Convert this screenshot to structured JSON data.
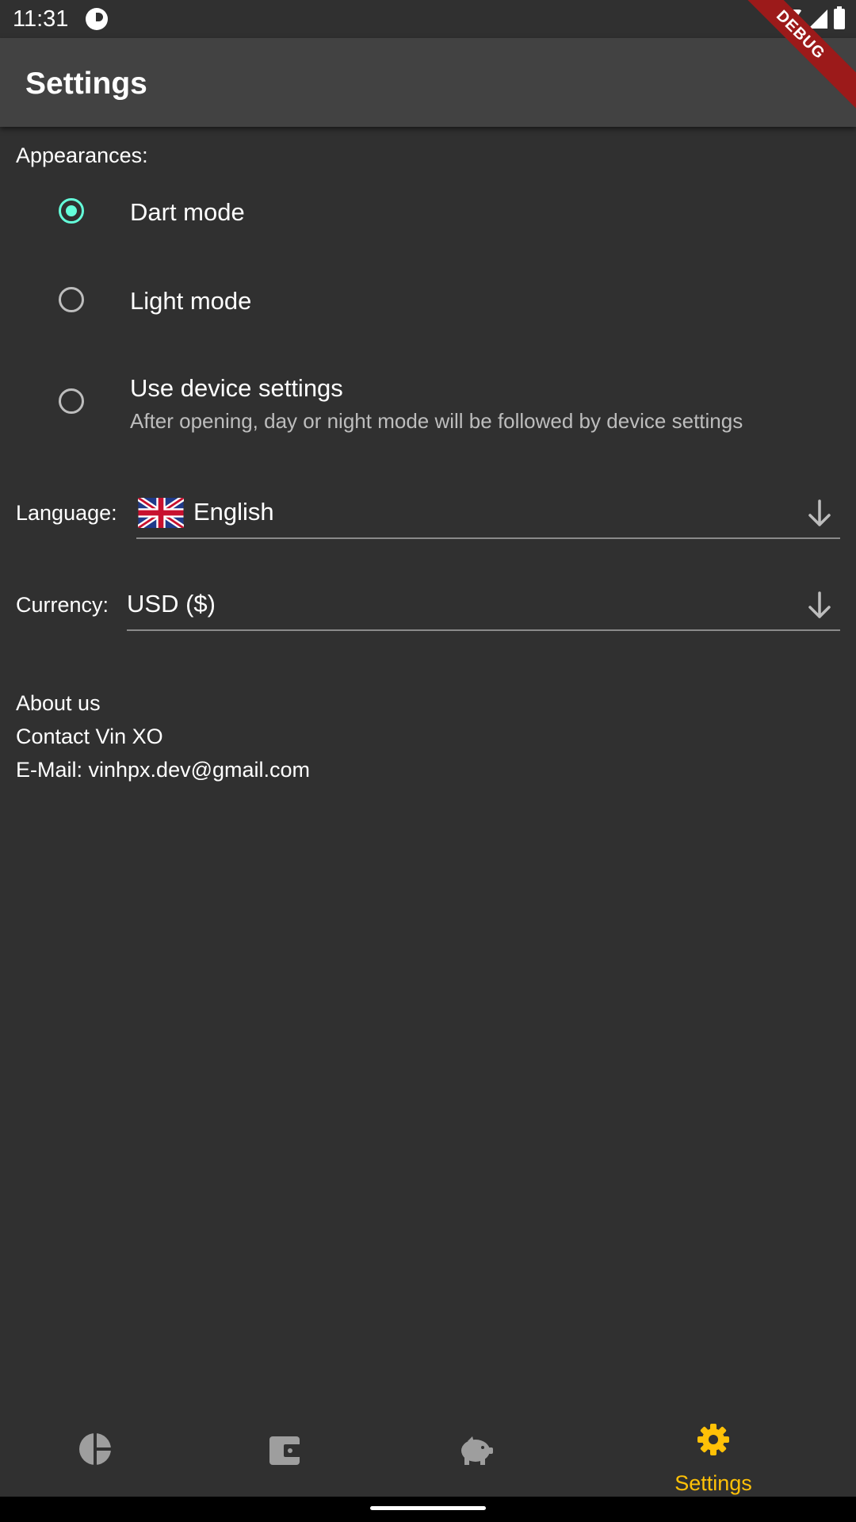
{
  "status_bar": {
    "time": "11:31"
  },
  "debug_banner": "DEBUG",
  "app_bar": {
    "title": "Settings"
  },
  "appearances": {
    "label": "Appearances:",
    "options": [
      {
        "title": "Dart mode",
        "selected": true
      },
      {
        "title": "Light mode",
        "selected": false
      },
      {
        "title": "Use device settings",
        "subtitle": "After opening, day or night mode will be followed by device settings",
        "selected": false
      }
    ]
  },
  "language": {
    "label": "Language:",
    "value": "English",
    "flag": "uk-flag-icon"
  },
  "currency": {
    "label": "Currency:",
    "value": "USD ($)"
  },
  "about": {
    "title": "About us",
    "contact": "Contact Vin XO",
    "email": "E-Mail: vinhpx.dev@gmail.com"
  },
  "bottom_nav": {
    "items": [
      {
        "icon": "pie-chart-icon"
      },
      {
        "icon": "wallet-icon"
      },
      {
        "icon": "piggy-bank-icon"
      },
      {
        "icon": "gear-icon",
        "label": "Settings",
        "active": true
      }
    ],
    "active_color": "#ffc107",
    "inactive_color": "#9e9e9e"
  },
  "colors": {
    "accent": "#64ffda",
    "background": "#303030",
    "app_bar": "#424242"
  }
}
